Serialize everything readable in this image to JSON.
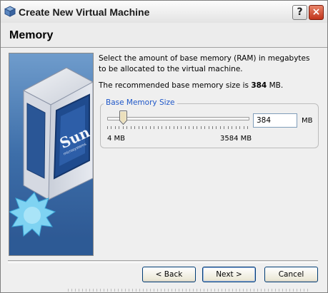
{
  "window": {
    "title": "Create New Virtual Machine",
    "help_label": "?",
    "close_label": "×"
  },
  "page": {
    "title": "Memory",
    "description": "Select the amount of base memory (RAM) in megabytes to be allocated to the virtual machine.",
    "recommended_prefix": "The recommended base memory size is ",
    "recommended_value": "384",
    "recommended_suffix": " MB."
  },
  "memory": {
    "group_title": "Base Memory Size",
    "value": "384",
    "unit": "MB",
    "min_label": "4 MB",
    "max_label": "3584 MB",
    "slider_min": 4,
    "slider_max": 3584,
    "slider_value": 384
  },
  "buttons": {
    "back": "< Back",
    "next": "Next >",
    "cancel": "Cancel"
  },
  "colors": {
    "group_title": "#1f57c8",
    "close_button": "#c1341b",
    "side_image_blue": "#3f71a9"
  },
  "side_image": {
    "logo_text": "Sun",
    "logo_subtext": "microsystems"
  }
}
